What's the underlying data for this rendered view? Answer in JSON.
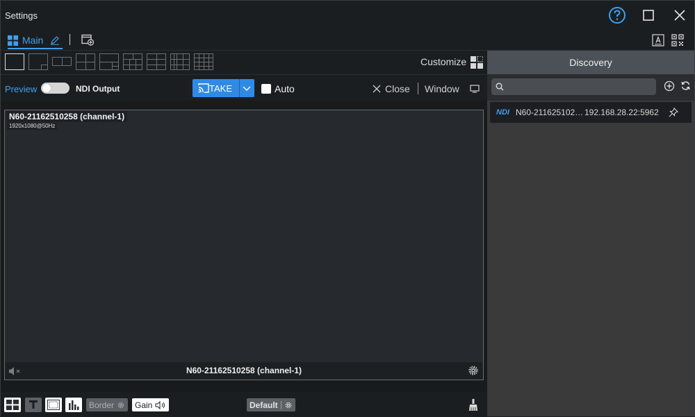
{
  "window": {
    "title": "Settings"
  },
  "tabs": {
    "main_label": "Main"
  },
  "toolbar": {
    "customize_label": "Customize"
  },
  "controls": {
    "preview_label": "Preview",
    "ndi_output_label": "NDI Output",
    "take_label": "TAKE",
    "auto_label": "Auto",
    "close_label": "Close",
    "window_label": "Window"
  },
  "monitor": {
    "source_name": "N60-21162510258 (channel-1)",
    "resolution": "1920x1080@50Hz",
    "footer_name": "N60-21162510258 (channel-1)"
  },
  "bottombar": {
    "border_label": "Border",
    "gain_label": "Gain",
    "default_label": "Default"
  },
  "discovery": {
    "title": "Discovery",
    "search_placeholder": "",
    "items": [
      {
        "badge": "NDI",
        "name": "N60-211625102…",
        "address": "192.168.28.22:5962"
      }
    ]
  },
  "colors": {
    "accent": "#3fa0f0",
    "take": "#2f8ae6",
    "panel": "#3a3a3a"
  }
}
